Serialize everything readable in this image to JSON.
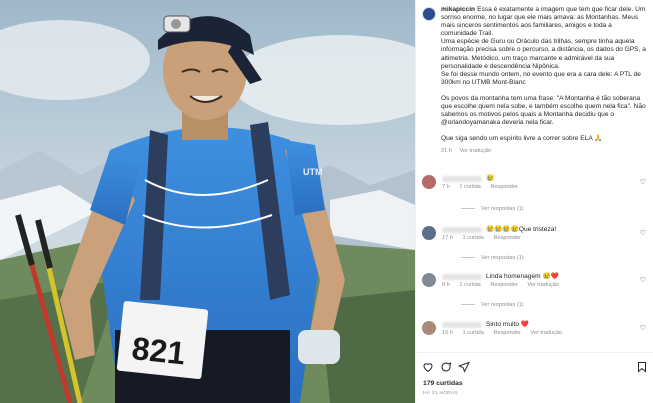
{
  "post": {
    "username": "mikapiccin",
    "caption_lines": [
      "Essa é exatamente a imagem que tem que ficar dele. Um sorriso enorme, no lugar que ele mais amava: as Montanhas. Meus mais sinceros sentimentos aos familiares, amigos e toda a comunidade Trail.",
      "Uma espécie de Guru ou Oráculo das trilhas, sempre tinha aquela informação precisa sobre o percurso, a distância, os dados do GPS, a altimetria. Metódico, um traço marcante e admirável da sua personalidade e descendência Nipônica.",
      "Se foi desse mundo ontem, no evento que era a cara dele: A PTL de 300km no UTMB Mont-Blanc",
      "Os povos da montanha tem uma frase: \"A Montanha é tão soberana que escolhe quem nela sobe, e também escolhe quem nela fica\". Não sabemos os motivos pelos quais a Montanha decidiu que o @orlandoyamanaka deveria nela ficar.",
      "Que siga sendo um espírito livre a correr sobre ELA 🙏"
    ],
    "caption_age": "21 h",
    "see_translation": "Ver tradução"
  },
  "photo": {
    "bib_number": "821",
    "shirt_text": "UTM"
  },
  "comments": [
    {
      "text": "😢",
      "age": "7 h",
      "likes": "1 curtida",
      "reply": "Responder",
      "translation": "",
      "replies": "Ver respostas (1)",
      "avatar_color": "#b56a6a"
    },
    {
      "text": "😢😢😢😢Que tristeza!",
      "age": "17 h",
      "likes": "1 curtida",
      "reply": "Responder",
      "translation": "",
      "replies": "Ver respostas (1)",
      "avatar_color": "#5a6f8a"
    },
    {
      "text": "Linda homenagem 😢❤️",
      "age": "8 h",
      "likes": "1 curtida",
      "reply": "Responder",
      "translation": "Ver tradução",
      "replies": "Ver respostas (1)",
      "avatar_color": "#7f8a95"
    },
    {
      "text": "Sinto muito ❤️",
      "age": "15 h",
      "likes": "1 curtida",
      "reply": "Responder",
      "translation": "Ver tradução",
      "replies": "",
      "avatar_color": "#a88a7a"
    }
  ],
  "actions": {
    "like_icon": "heart-icon",
    "comment_icon": "comment-icon",
    "share_icon": "send-icon",
    "save_icon": "bookmark-icon",
    "likes_count": "179 curtidas",
    "timestamp": "HÁ 21 HORAS"
  }
}
